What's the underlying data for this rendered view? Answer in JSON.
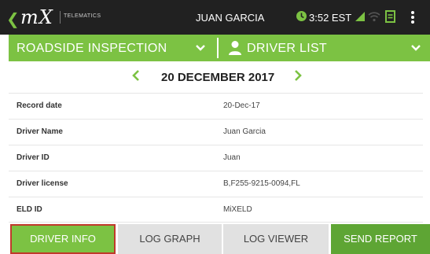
{
  "topbar": {
    "logo": "mX",
    "brand_sub": "TELEMATICS",
    "user": "JUAN GARCIA",
    "time": "3:52 EST"
  },
  "header": {
    "left_title": "ROADSIDE INSPECTION",
    "right_title": "DRIVER LIST"
  },
  "date_nav": {
    "date": "20 DECEMBER 2017"
  },
  "rows": [
    {
      "label": "Record date",
      "value": "20-Dec-17"
    },
    {
      "label": "Driver Name",
      "value": "Juan Garcia"
    },
    {
      "label": "Driver ID",
      "value": "Juan"
    },
    {
      "label": "Driver license",
      "value": "B,F255-9215-0094,FL"
    },
    {
      "label": "ELD ID",
      "value": "MiXELD"
    }
  ],
  "tabs": {
    "driver_info": "DRIVER INFO",
    "log_graph": "LOG GRAPH",
    "log_viewer": "LOG VIEWER",
    "send_report": "SEND REPORT"
  },
  "colors": {
    "accent": "#7cc243",
    "accent_dark": "#5ea534",
    "topbar": "#212121",
    "selected_border": "#c0392b"
  }
}
